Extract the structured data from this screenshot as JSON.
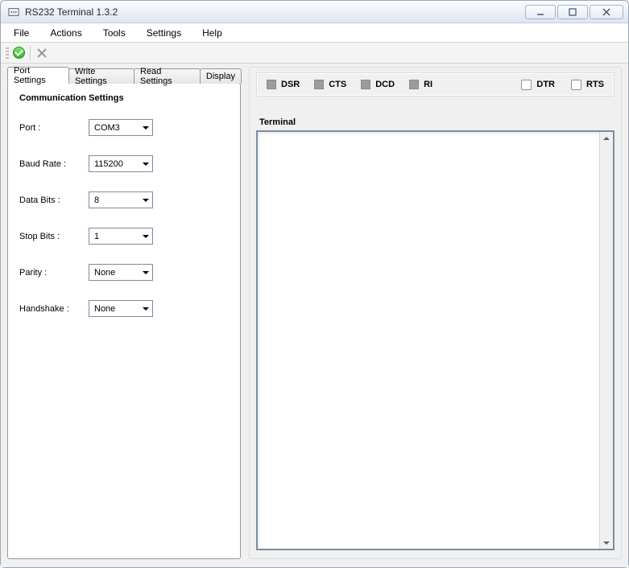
{
  "window": {
    "title": "RS232 Terminal 1.3.2"
  },
  "menu": {
    "file": "File",
    "actions": "Actions",
    "tools": "Tools",
    "settings": "Settings",
    "help": "Help"
  },
  "tabs": {
    "port": "Port Settings",
    "write": "Write Settings",
    "read": "Read Settings",
    "display": "Display"
  },
  "comm": {
    "group_title": "Communication Settings",
    "port_label": "Port :",
    "port_value": "COM3",
    "baud_label": "Baud Rate :",
    "baud_value": "115200",
    "databits_label": "Data Bits :",
    "databits_value": "8",
    "stopbits_label": "Stop Bits :",
    "stopbits_value": "1",
    "parity_label": "Parity :",
    "parity_value": "None",
    "handshake_label": "Handshake :",
    "handshake_value": "None"
  },
  "status": {
    "dsr": "DSR",
    "cts": "CTS",
    "dcd": "DCD",
    "ri": "RI",
    "dtr": "DTR",
    "rts": "RTS"
  },
  "terminal": {
    "label": "Terminal"
  }
}
